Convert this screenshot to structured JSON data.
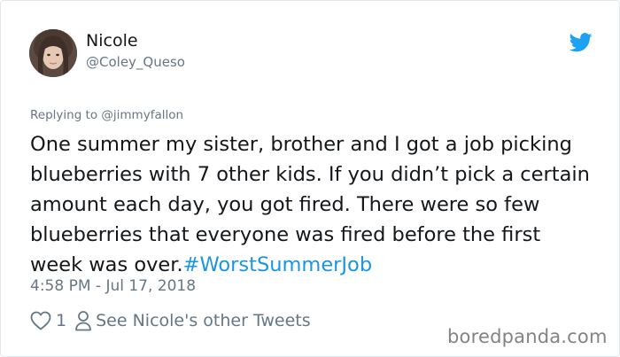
{
  "user": {
    "display_name": "Nicole",
    "handle": "@Coley_Queso"
  },
  "replying_to": "Replying to @jimmyfallon",
  "tweet": {
    "text": "One summer my sister, brother and I got a job picking blueberries with 7 other kids. If you didn’t pick a certain amount each day, you got fired. There were so few blueberries that everyone was fired before the first week was over.",
    "hashtag": "#WorstSummerJob",
    "timestamp": "4:58 PM - Jul 17, 2018"
  },
  "actions": {
    "like_count": "1",
    "see_other_label": "See Nicole's other Tweets"
  },
  "watermark": "boredpanda.com",
  "colors": {
    "twitter_blue": "#1da1f2",
    "hashtag": "#1b95e0",
    "secondary_text": "#657786",
    "primary_text": "#14171a"
  },
  "icons": {
    "logo": "twitter-bird-icon",
    "like": "heart-icon",
    "profile": "person-icon"
  }
}
